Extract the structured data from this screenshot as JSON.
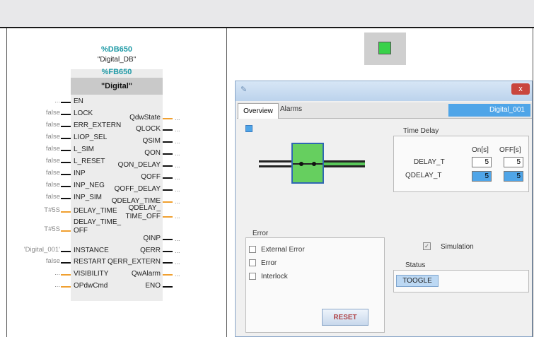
{
  "block": {
    "db_number": "%DB650",
    "db_name": "\"Digital_DB\"",
    "fb_number": "%FB650",
    "fb_name": "\"Digital\"",
    "inputs": [
      {
        "value": "...",
        "name": "EN",
        "wire": "black"
      },
      {
        "value": "false",
        "name": "LOCK",
        "wire": "black"
      },
      {
        "value": "false",
        "name": "ERR_EXTERN",
        "wire": "black"
      },
      {
        "value": "false",
        "name": "LIOP_SEL",
        "wire": "black"
      },
      {
        "value": "false",
        "name": "L_SIM",
        "wire": "black"
      },
      {
        "value": "false",
        "name": "L_RESET",
        "wire": "black"
      },
      {
        "value": "false",
        "name": "INP",
        "wire": "black"
      },
      {
        "value": "false",
        "name": "INP_NEG",
        "wire": "black"
      },
      {
        "value": "false",
        "name": "INP_SIM",
        "wire": "black"
      },
      {
        "value": "T#5S",
        "name": "DELAY_TIME",
        "wire": "orange"
      },
      {
        "value": "T#5S",
        "name": "DELAY_TIME_ OFF",
        "wire": "orange"
      },
      {
        "value": "'Digital_001'",
        "name": "INSTANCE",
        "wire": "black"
      },
      {
        "value": "false",
        "name": "RESTART",
        "wire": "black"
      },
      {
        "value": "...",
        "name": "VISIBILITY",
        "wire": "orange"
      },
      {
        "value": "...",
        "name": "OPdwCmd",
        "wire": "orange"
      }
    ],
    "outputs": [
      {
        "name": "QdwState",
        "wire": "orange"
      },
      {
        "name": "QLOCK",
        "wire": "black"
      },
      {
        "name": "QSIM",
        "wire": "black"
      },
      {
        "name": "QON",
        "wire": "black"
      },
      {
        "name": "QON_DELAY",
        "wire": "black"
      },
      {
        "name": "QOFF",
        "wire": "black"
      },
      {
        "name": "QOFF_DELAY",
        "wire": "black"
      },
      {
        "name": "QDELAY_TIME",
        "wire": "orange"
      },
      {
        "name": "QDELAY_ TIME_OFF",
        "wire": "orange"
      },
      {
        "name": "QINP",
        "wire": "black"
      },
      {
        "name": "QERR",
        "wire": "black"
      },
      {
        "name": "QERR_EXTERN",
        "wire": "black"
      },
      {
        "name": "QwAlarm",
        "wire": "orange"
      },
      {
        "name": "ENO",
        "wire": "black"
      }
    ],
    "output_placeholder": "..."
  },
  "indicator": {
    "color": "#39d14a"
  },
  "faceplate": {
    "tabs": [
      "Overview",
      "Alarms"
    ],
    "instance_name": "Digital_001",
    "close_glyph": "x",
    "time_delay": {
      "title": "Time Delay",
      "col_on": "On[s]",
      "col_off": "OFF[s]",
      "rows": [
        {
          "label": "DELAY_T",
          "on": "5",
          "off": "5"
        },
        {
          "label": "QDELAY_T",
          "on": "5",
          "off": "5"
        }
      ]
    },
    "error": {
      "title": "Error",
      "items": [
        "External Error",
        "Error",
        "Interlock"
      ]
    },
    "reset_label": "RESET",
    "simulation_label": "Simulation",
    "simulation_checked": true,
    "status": {
      "title": "Status",
      "button": "TOOGLE"
    }
  }
}
